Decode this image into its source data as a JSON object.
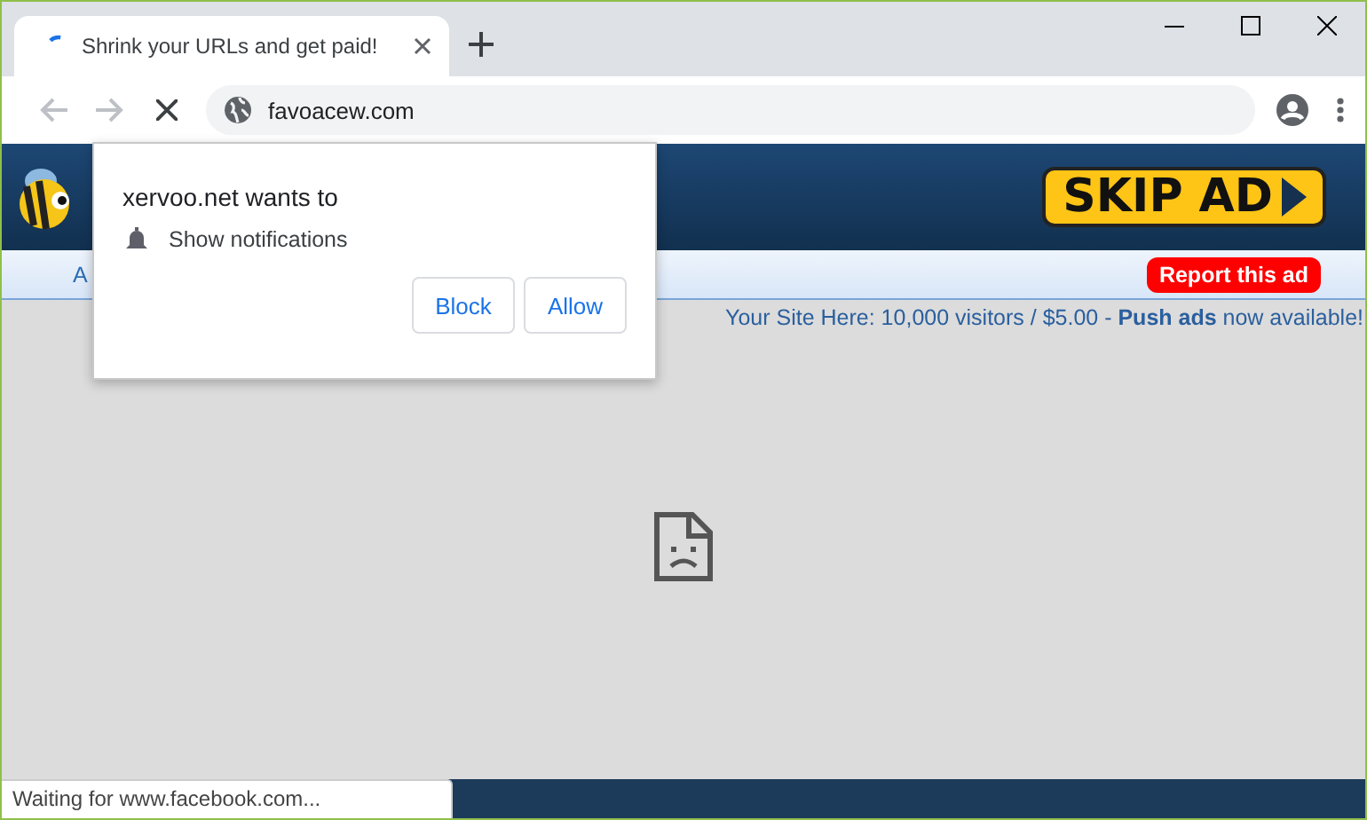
{
  "window": {
    "tab": {
      "title": "Shrink your URLs and get paid!",
      "loading": true
    },
    "address": "favoacew.com"
  },
  "page": {
    "nav_partial": "A",
    "skip_ad": "SKIP AD",
    "report": "Report this ad",
    "banner": "Your Site Here: 10,000 visitors / $5.00 - **Push ads** now available!"
  },
  "permission_prompt": {
    "title": "xervoo.net wants to",
    "request": "Show notifications",
    "buttons": [
      "Block",
      "Allow"
    ]
  },
  "status_bar": "Waiting for www.facebook.com..."
}
